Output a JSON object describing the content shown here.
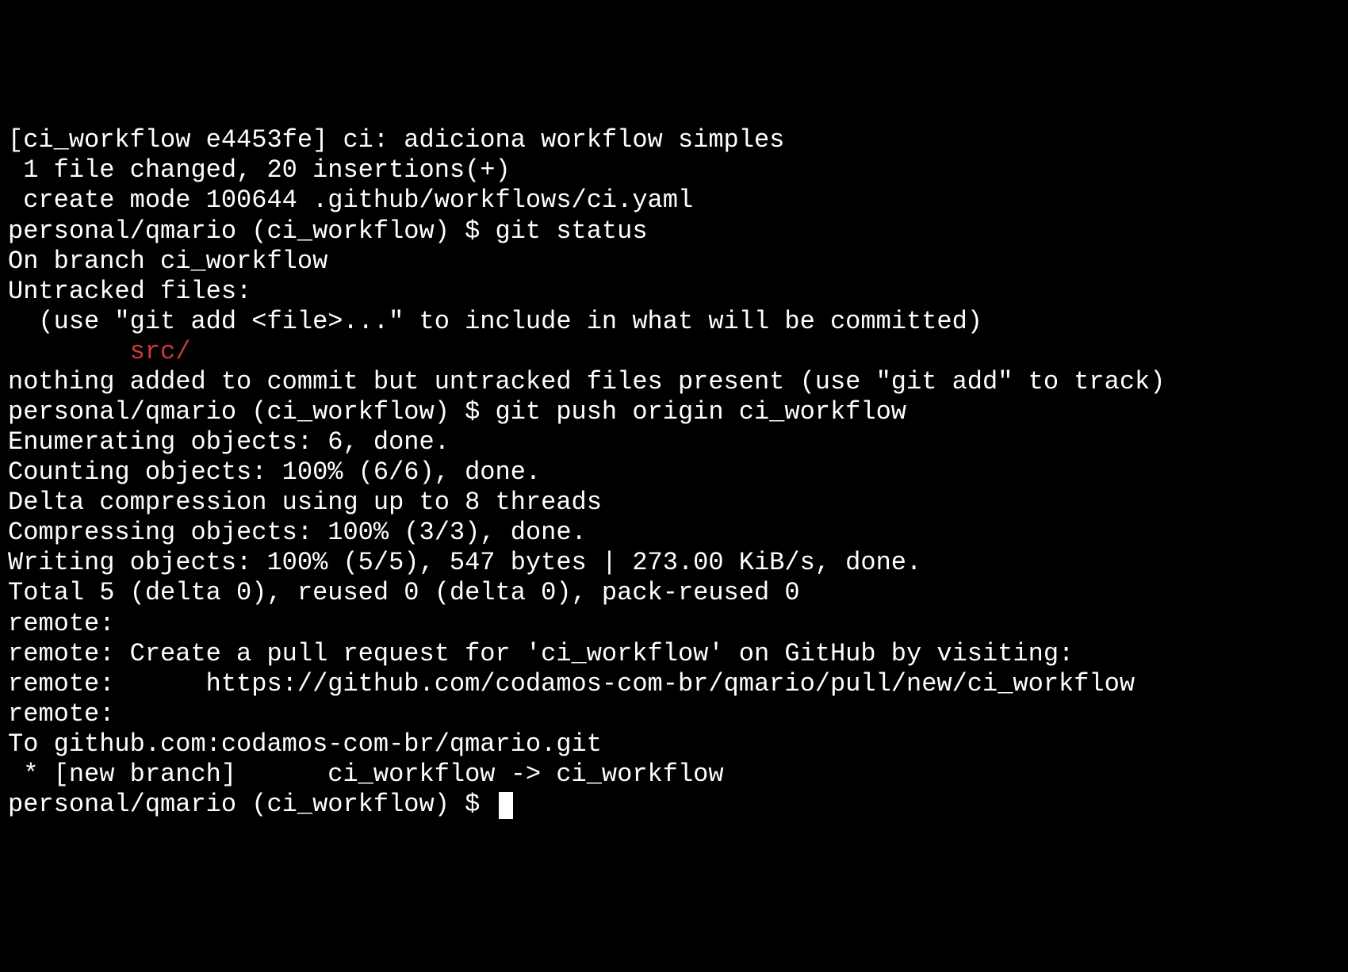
{
  "lines": {
    "commit_header": "[ci_workflow e4453fe] ci: adiciona workflow simples",
    "commit_stat": " 1 file changed, 20 insertions(+)",
    "commit_create": " create mode 100644 .github/workflows/ci.yaml",
    "prompt1_prefix": "personal/qmario (ci_workflow) $ ",
    "prompt1_cmd": "git status",
    "status_branch": "On branch ci_workflow",
    "status_untracked_header": "Untracked files:",
    "status_untracked_hint": "  (use \"git add <file>...\" to include in what will be committed)",
    "status_untracked_file_indent": "        ",
    "status_untracked_file": "src/",
    "status_blank": "",
    "status_nothing": "nothing added to commit but untracked files present (use \"git add\" to track)",
    "prompt2_prefix": "personal/qmario (ci_workflow) $ ",
    "prompt2_cmd": "git push origin ci_workflow",
    "push_enumerating": "Enumerating objects: 6, done.",
    "push_counting": "Counting objects: 100% (6/6), done.",
    "push_delta": "Delta compression using up to 8 threads",
    "push_compressing": "Compressing objects: 100% (3/3), done.",
    "push_writing": "Writing objects: 100% (5/5), 547 bytes | 273.00 KiB/s, done.",
    "push_total": "Total 5 (delta 0), reused 0 (delta 0), pack-reused 0",
    "push_remote1": "remote: ",
    "push_remote2": "remote: Create a pull request for 'ci_workflow' on GitHub by visiting:",
    "push_remote3": "remote:      https://github.com/codamos-com-br/qmario/pull/new/ci_workflow",
    "push_remote4": "remote: ",
    "push_to": "To github.com:codamos-com-br/qmario.git",
    "push_newbranch": " * [new branch]      ci_workflow -> ci_workflow",
    "prompt3_prefix": "personal/qmario (ci_workflow) $ "
  }
}
